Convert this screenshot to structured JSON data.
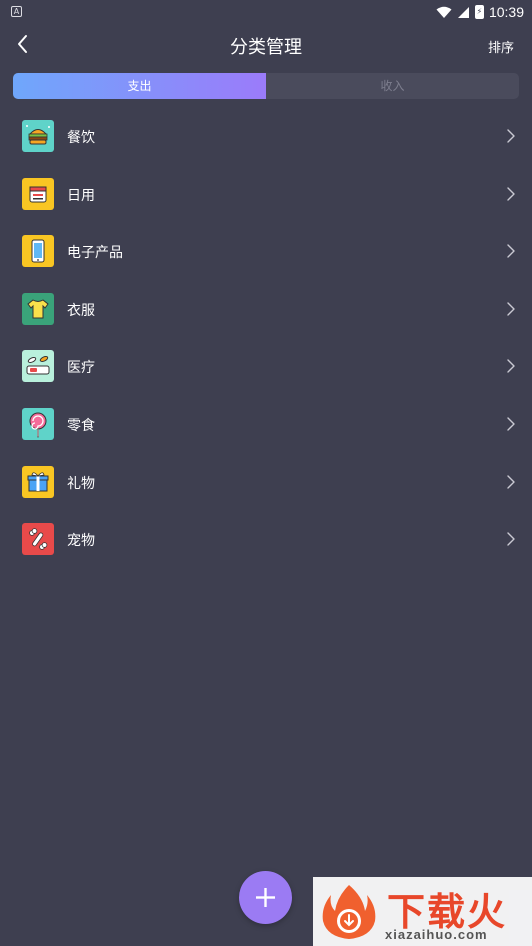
{
  "status_bar": {
    "left_icon": "A",
    "time": "10:39",
    "battery_glyph": "⚡",
    "icons": [
      "wifi-icon",
      "signal-icon",
      "battery-icon"
    ]
  },
  "header": {
    "title": "分类管理",
    "sort_label": "排序",
    "back_icon": "chevron-left-icon"
  },
  "tabs": [
    {
      "label": "支出",
      "active": true
    },
    {
      "label": "收入",
      "active": false
    }
  ],
  "categories": [
    {
      "label": "餐饮",
      "icon": "burger-icon"
    },
    {
      "label": "日用",
      "icon": "daily-goods-icon"
    },
    {
      "label": "电子产品",
      "icon": "phone-icon"
    },
    {
      "label": "衣服",
      "icon": "shirt-icon"
    },
    {
      "label": "医疗",
      "icon": "medicine-icon"
    },
    {
      "label": "零食",
      "icon": "lollipop-icon"
    },
    {
      "label": "礼物",
      "icon": "gift-icon"
    },
    {
      "label": "宠物",
      "icon": "pet-icon"
    }
  ],
  "fab_icon": "plus-icon",
  "watermark": {
    "brand": "下载火",
    "url": "xiazaihuo.com"
  },
  "colors": {
    "background": "#3e3f50",
    "tab_gradient_start": "#6fa7fb",
    "tab_gradient_end": "#9b7bfa",
    "fab": "#9b7bf3"
  }
}
